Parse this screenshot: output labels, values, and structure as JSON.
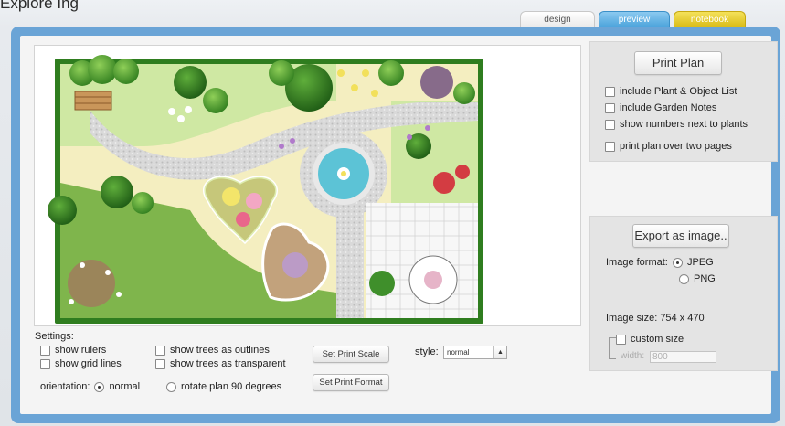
{
  "page": {
    "heading": "Explore Ing"
  },
  "tabs": [
    {
      "label": "design"
    },
    {
      "label": "preview"
    },
    {
      "label": "notebook"
    }
  ],
  "print_panel": {
    "print_button": "Print Plan",
    "options": [
      {
        "label": "include Plant & Object List",
        "checked": false
      },
      {
        "label": "include Garden Notes",
        "checked": false
      },
      {
        "label": "show numbers next to plants",
        "checked": false
      },
      {
        "label": "print plan over two pages",
        "checked": false
      }
    ]
  },
  "export_panel": {
    "export_button": "Export as image..",
    "format_label": "Image format:",
    "formats": [
      {
        "label": "JPEG",
        "selected": true
      },
      {
        "label": "PNG",
        "selected": false
      }
    ],
    "size_label": "Image size:",
    "size_value": "754 x 470",
    "custom_size_label": "custom size",
    "width_label": "width:",
    "width_value": "800"
  },
  "settings": {
    "heading": "Settings:",
    "checkboxes": [
      {
        "label": "show rulers",
        "checked": false
      },
      {
        "label": "show grid lines",
        "checked": false
      },
      {
        "label": "show trees as outlines",
        "checked": false
      },
      {
        "label": "show trees as transparent",
        "checked": false
      }
    ],
    "orientation_label": "orientation:",
    "orientation_options": [
      {
        "label": "normal",
        "selected": true
      },
      {
        "label": "rotate plan 90 degrees",
        "selected": false
      }
    ],
    "set_print_scale": "Set Print Scale",
    "set_print_format": "Set Print Format",
    "style_label": "style:",
    "style_value": "normal"
  },
  "colors": {
    "frame_blue": "#6aa4d6",
    "tab_preview": "#4aa3db",
    "tab_notebook": "#d9bb15",
    "lawn": "#cfe8a3",
    "path_gravel": "#d6d6d6",
    "hedge": "#2e7d1f",
    "water": "#5cc3d6"
  }
}
